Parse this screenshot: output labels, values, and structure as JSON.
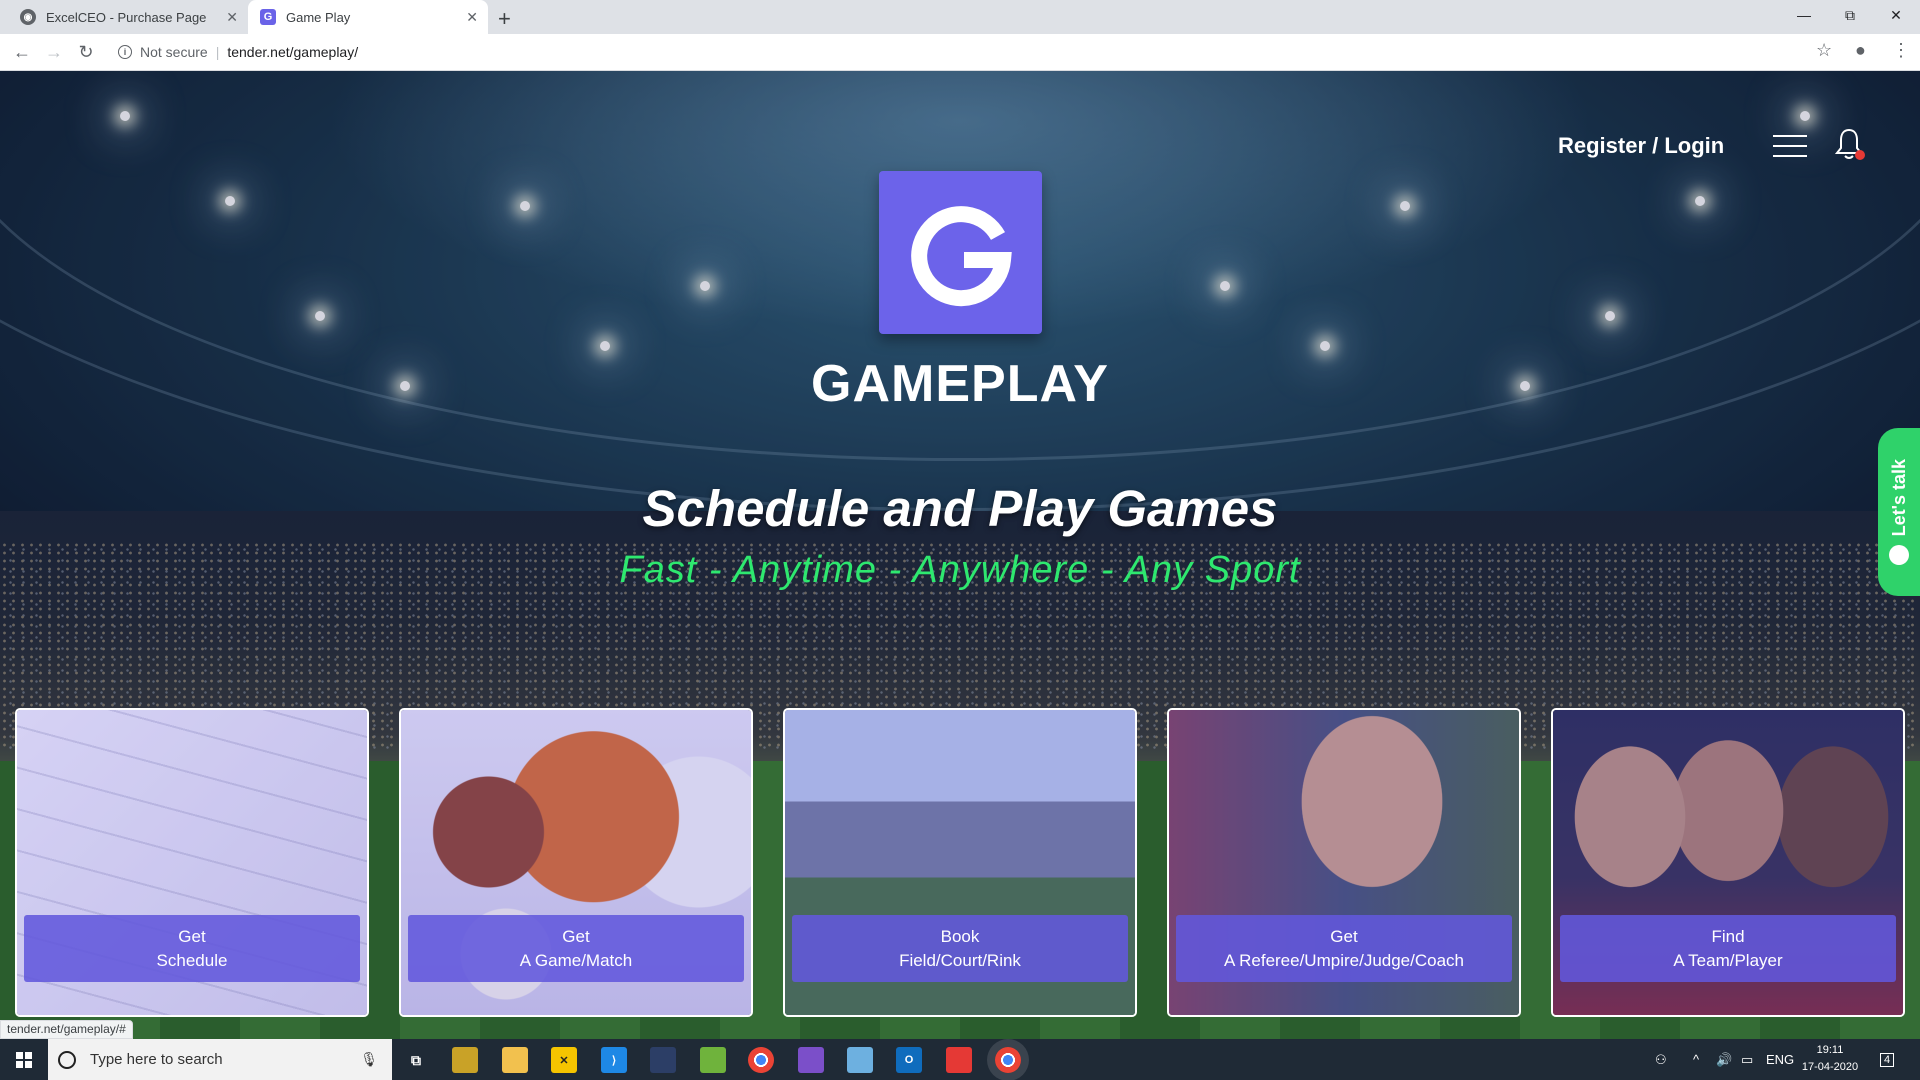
{
  "browser": {
    "tabs": [
      {
        "title": "ExcelCEO - Purchase Page",
        "active": false
      },
      {
        "title": "Game Play",
        "active": true
      }
    ],
    "security_label": "Not secure",
    "url": "tender.net/gameplay/",
    "status_url": "tender.net/gameplay/#"
  },
  "header": {
    "login_label": "Register / Login"
  },
  "brand": {
    "logo_letter": "G",
    "name": "GAMEPLAY",
    "color": "#6c63ea"
  },
  "hero": {
    "headline": "Schedule and Play Games",
    "tagline": "Fast - Anytime - Anywhere - Any Sport",
    "tagline_color": "#2ee86f"
  },
  "chat_widget": {
    "label": "Let's talk",
    "color": "#2fd26a"
  },
  "cards": [
    {
      "line1": "Get",
      "line2": "Schedule"
    },
    {
      "line1": "Get",
      "line2": "A Game/Match"
    },
    {
      "line1": "Book",
      "line2": "Field/Court/Rink"
    },
    {
      "line1": "Get",
      "line2": "A Referee/Umpire/Judge/Coach"
    },
    {
      "line1": "Find",
      "line2": "A Team/Player"
    }
  ],
  "taskbar": {
    "search_placeholder": "Type here to search",
    "language": "ENG",
    "time": "19:11",
    "date": "17-04-2020",
    "notification_count": "4"
  }
}
